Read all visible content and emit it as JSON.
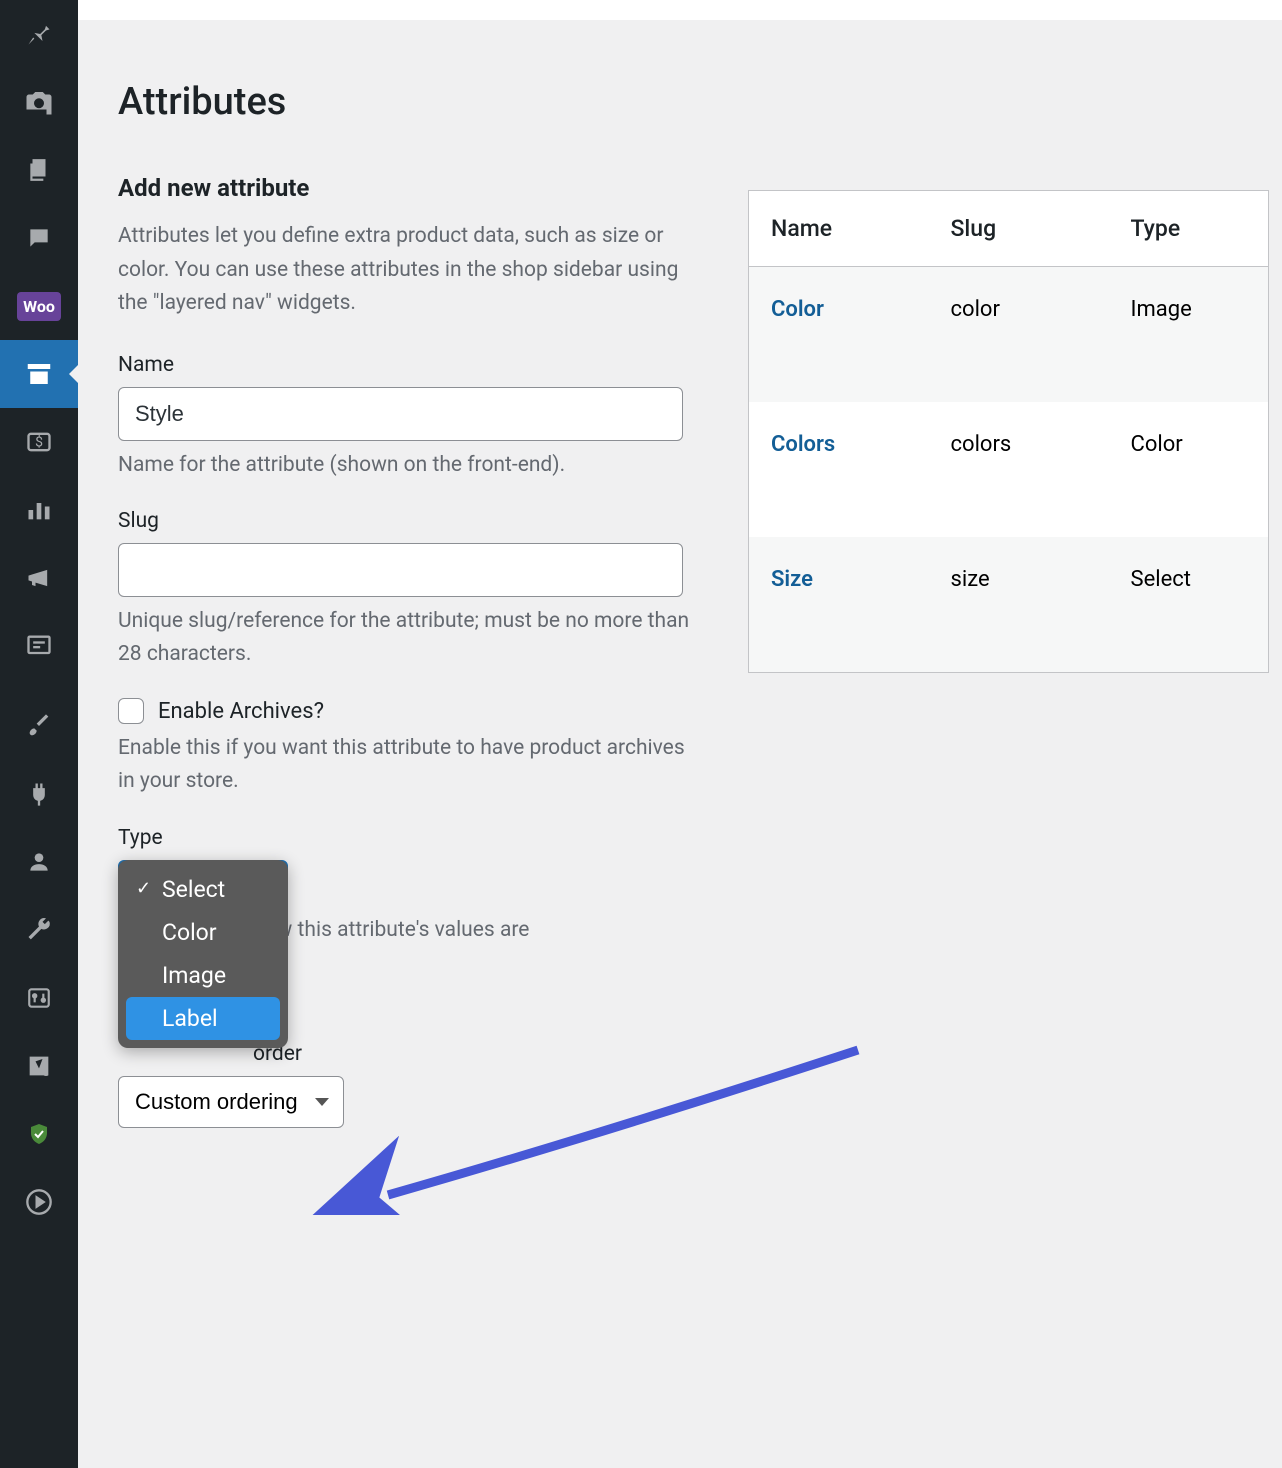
{
  "page": {
    "title": "Attributes"
  },
  "form": {
    "heading": "Add new attribute",
    "description": "Attributes let you define extra product data, such as size or color. You can use these attributes in the shop sidebar using the \"layered nav\" widgets.",
    "name": {
      "label": "Name",
      "value": "Style",
      "help": "Name for the attribute (shown on the front-end)."
    },
    "slug": {
      "label": "Slug",
      "value": "",
      "help": "Unique slug/reference for the attribute; must be no more than 28 characters."
    },
    "archives": {
      "label": "Enable Archives?",
      "help": "Enable this if you want this attribute to have product archives in your store."
    },
    "type": {
      "label": "Type",
      "help": "how this attribute's values are",
      "options": [
        "Select",
        "Color",
        "Image",
        "Label"
      ],
      "selected": "Select",
      "highlighted": "Label"
    },
    "sort": {
      "label": "order",
      "value": "Custom ordering"
    }
  },
  "table": {
    "headers": {
      "name": "Name",
      "slug": "Slug",
      "type": "Type"
    },
    "rows": [
      {
        "name": "Color",
        "slug": "color",
        "type": "Image"
      },
      {
        "name": "Colors",
        "slug": "colors",
        "type": "Color"
      },
      {
        "name": "Size",
        "slug": "size",
        "type": "Select"
      }
    ]
  }
}
